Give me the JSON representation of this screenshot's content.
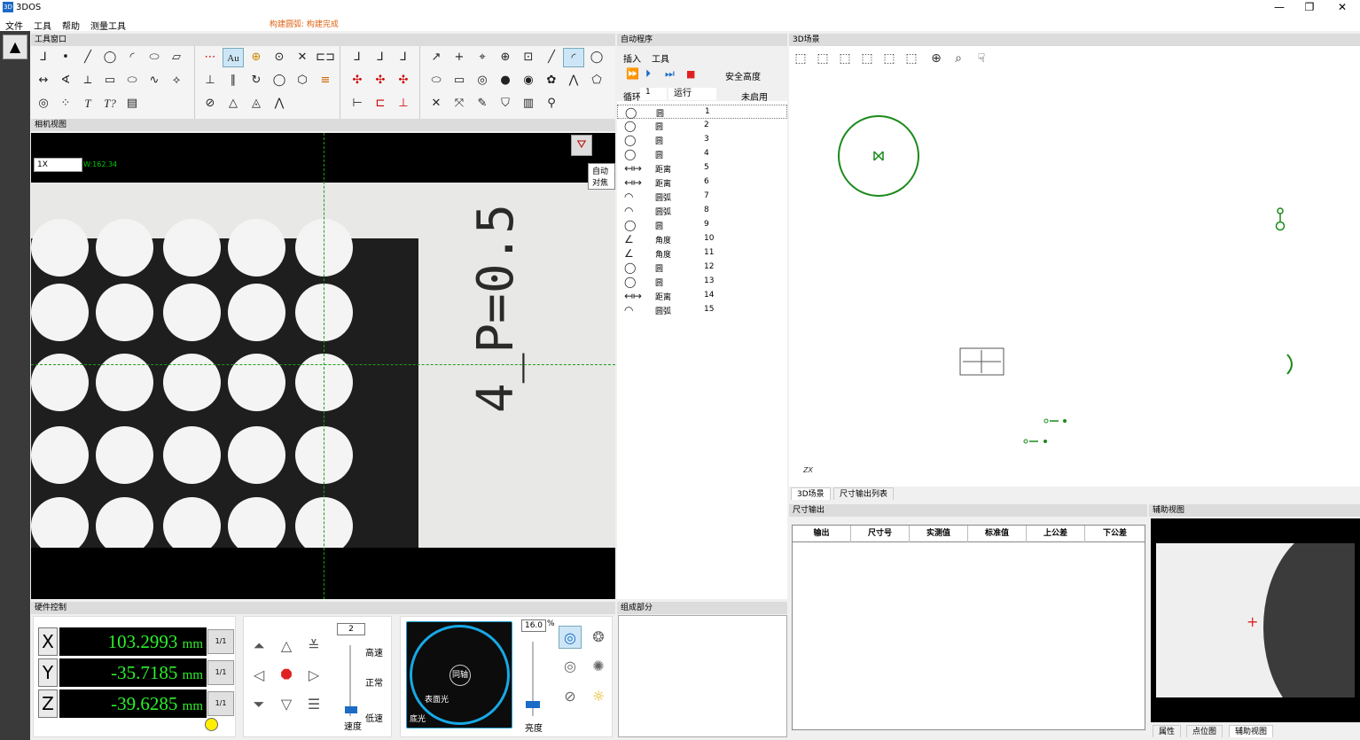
{
  "app": {
    "icon_text": "3D",
    "title": "3DOS"
  },
  "window": {
    "minimize": "—",
    "restore": "❐",
    "close": "✕"
  },
  "menu": {
    "file": "文件",
    "tools": "工具",
    "help": "帮助",
    "measure": "测量工具",
    "status": "构建圆弧: 构建完成"
  },
  "panels": {
    "tools": "工具窗口",
    "camera": "相机视图",
    "hardware": "硬件控制",
    "auto": "自动程序",
    "components": "组成部分",
    "scene": "3D场景",
    "dim_output": "尺寸输出",
    "aux": "辅助视图"
  },
  "camera": {
    "zoom": "1X",
    "w_readout": "W:162.34",
    "focus_tooltip": "自动对焦",
    "plate_text": "4_P=0.5"
  },
  "hardware": {
    "axes": [
      {
        "label": "X",
        "value": "103.2993",
        "unit": "mm",
        "btn": "1/1"
      },
      {
        "label": "Y",
        "value": "-35.7185",
        "unit": "mm",
        "btn": "1/1"
      },
      {
        "label": "Z",
        "value": "-39.6285",
        "unit": "mm",
        "btn": "1/1"
      }
    ],
    "speed_value": "2",
    "speed_high": "高速",
    "speed_normal": "正常",
    "speed_low": "低速",
    "speed_label": "速度",
    "brightness_value": "16.0",
    "brightness_unit": "%",
    "brightness_label": "亮度",
    "coax": "同轴",
    "surface_light": "表面光",
    "bottom_light": "底光"
  },
  "auto": {
    "tab_insert": "插入",
    "tab_tools": "工具",
    "safe_height": "安全高度",
    "loop_label": "循环",
    "loop_value": "1",
    "run_label": "运行",
    "disabled_label": "未启用",
    "items": [
      {
        "icon": "circle-icon",
        "glyph": "◯",
        "name": "圆",
        "id": "1"
      },
      {
        "icon": "circle-icon",
        "glyph": "◯",
        "name": "圆",
        "id": "2"
      },
      {
        "icon": "circle-icon",
        "glyph": "◯",
        "name": "圆",
        "id": "3"
      },
      {
        "icon": "circle-icon",
        "glyph": "◯",
        "name": "圆",
        "id": "4"
      },
      {
        "icon": "distance-icon",
        "glyph": "↤↦",
        "name": "距离",
        "id": "5"
      },
      {
        "icon": "distance-icon",
        "glyph": "↤↦",
        "name": "距离",
        "id": "6"
      },
      {
        "icon": "arc-icon",
        "glyph": "◠",
        "name": "圆弧",
        "id": "7"
      },
      {
        "icon": "arc-icon",
        "glyph": "◠",
        "name": "圆弧",
        "id": "8"
      },
      {
        "icon": "circle-icon",
        "glyph": "◯",
        "name": "圆",
        "id": "9"
      },
      {
        "icon": "angle-icon",
        "glyph": "∠",
        "name": "角度",
        "id": "10"
      },
      {
        "icon": "angle-icon",
        "glyph": "∠",
        "name": "角度",
        "id": "11"
      },
      {
        "icon": "circle-icon",
        "glyph": "◯",
        "name": "圆",
        "id": "12"
      },
      {
        "icon": "circle-icon",
        "glyph": "◯",
        "name": "圆",
        "id": "13"
      },
      {
        "icon": "distance-icon",
        "glyph": "↤↦",
        "name": "距离",
        "id": "14"
      },
      {
        "icon": "arc-icon",
        "glyph": "◠",
        "name": "圆弧",
        "id": "15"
      }
    ]
  },
  "scene": {
    "tab_3d": "3D场景",
    "tab_list": "尺寸输出列表",
    "axis_label": "ZX"
  },
  "dim_table": {
    "headers": [
      "输出",
      "尺寸号",
      "实测值",
      "标准值",
      "上公差",
      "下公差"
    ]
  },
  "aux_tabs": [
    "属性",
    "点位图",
    "辅助视图"
  ],
  "colors": {
    "accent": "#1c6bc7",
    "readout": "#2cf02c",
    "geometry": "#1a8a1a",
    "stop": "#e02020"
  }
}
